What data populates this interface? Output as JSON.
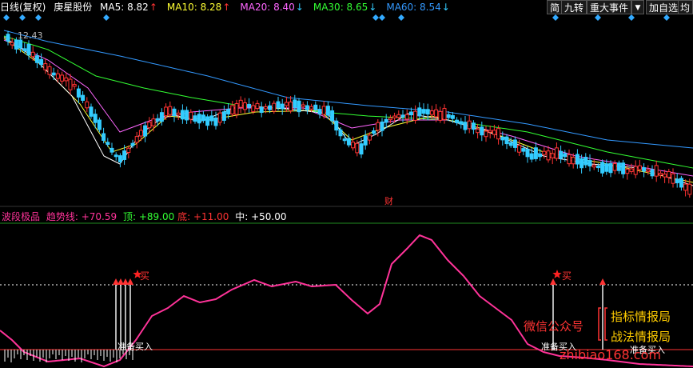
{
  "header": {
    "period": "日线(复权)",
    "stock_name": "庚星股份",
    "ma": [
      {
        "label": "MA5:",
        "value": "8.82",
        "arrow": "↑",
        "color": "#ffffff"
      },
      {
        "label": "MA10:",
        "value": "8.28",
        "arrow": "↑",
        "color": "#ffff33"
      },
      {
        "label": "MA20:",
        "value": "8.40",
        "arrow": "↓",
        "color": "#ff66ff"
      },
      {
        "label": "MA30:",
        "value": "8.65",
        "arrow": "↓",
        "color": "#33ff33"
      },
      {
        "label": "MA60:",
        "value": "8.54",
        "arrow": "↓",
        "color": "#3399ff"
      }
    ]
  },
  "toolbar": {
    "simple": "简",
    "nine_turn": "九转",
    "major_events": "重大事件",
    "dropdown_icon": "▼",
    "add_watchlist": "加自选",
    "more": "均线"
  },
  "price_chart": {
    "high_price_label": "12.43",
    "event_marker": "财"
  },
  "indicator": {
    "name": "波段极品",
    "trend_label": "趋势线:",
    "trend_value": "+70.59",
    "top_label": "顶:",
    "top_value": "+89.00",
    "bottom_label": "底:",
    "bottom_value": "+11.00",
    "mid_label": "中:",
    "mid_value": "+50.00",
    "signal_buy": "买",
    "signal_prepare": "准备买入"
  },
  "watermark": {
    "wechat": "微信公众号",
    "brand1": "指标情报局",
    "brand2": "战法情报局",
    "site": "zhibiao168.com"
  },
  "colors": {
    "background": "#000000",
    "up": "#ff3333",
    "down": "#33ccff",
    "trend_line": "#ff3399",
    "brand": "#ff3333"
  }
}
